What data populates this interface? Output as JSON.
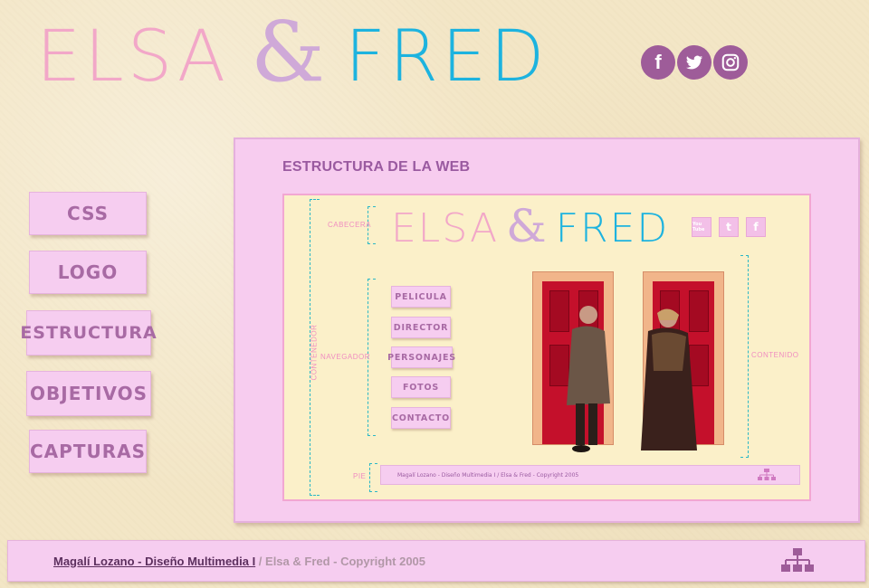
{
  "brand": {
    "part1": "ELSA",
    "amp": "&",
    "part2": "FRED"
  },
  "social": [
    {
      "name": "facebook-icon",
      "glyph": "f"
    },
    {
      "name": "twitter-icon",
      "glyph": ""
    },
    {
      "name": "instagram-icon",
      "glyph": ""
    }
  ],
  "menu": [
    "CSS",
    "LOGO",
    "ESTRUCTURA",
    "OBJETIVOS",
    "CAPTURAS"
  ],
  "panel": {
    "title": "ESTRUCTURA DE LA WEB"
  },
  "mockup": {
    "brand": {
      "part1": "ELSA",
      "amp": "&",
      "part2": "FRED"
    },
    "social": [
      "You Tube",
      "t",
      "f"
    ],
    "labels": {
      "cabecera": "CABECERA",
      "contenedor": "CONTENEDOR",
      "navegador": "NAVEGADOR",
      "contenido": "CONTENIDO",
      "pie": "PIE"
    },
    "nav": [
      "PELICULA",
      "DIRECTOR",
      "PERSONAJES",
      "FOTOS",
      "CONTACTO"
    ],
    "footer": "Magalí Lozano - Diseño Multimedia I / Elsa & Fred - Copyright 2005"
  },
  "footer": {
    "link": "Magalí Lozano - Diseño Multimedia I",
    "rest": " / Elsa & Fred - Copyright 2005"
  },
  "colors": {
    "background": "#f3e6c6",
    "panel": "#f7ccef",
    "pink": "#f2a7c8",
    "cyan": "#1db3df",
    "purple": "#9e5c99"
  }
}
